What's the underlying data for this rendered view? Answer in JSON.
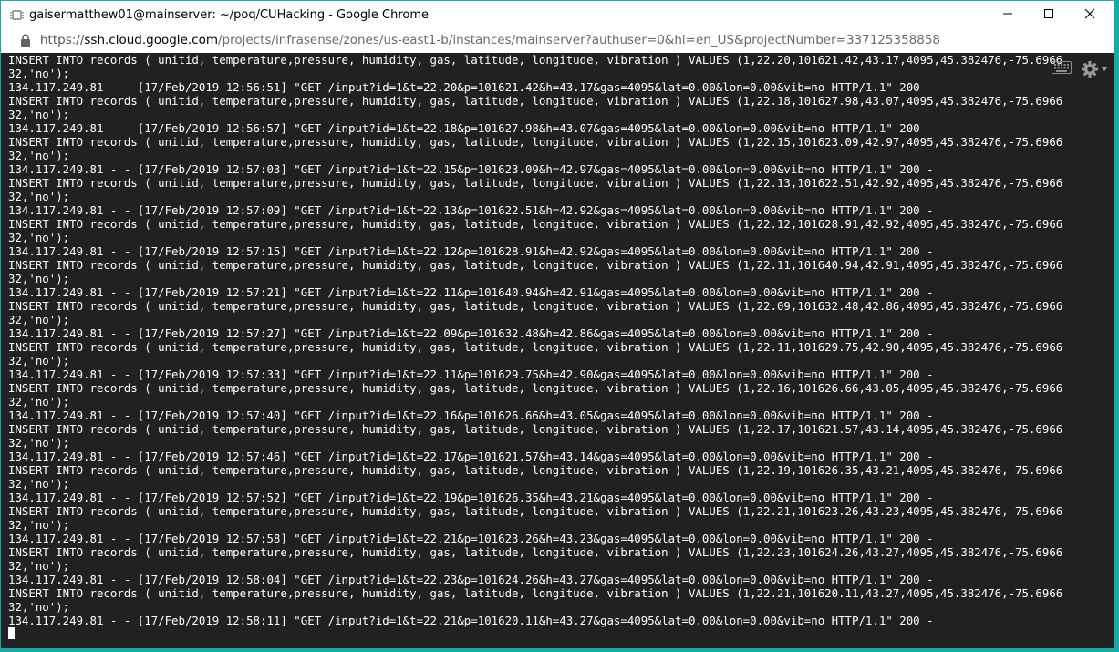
{
  "window": {
    "title": "gaisermatthew01@mainserver: ~/poq/CUHacking - Google Chrome"
  },
  "address": {
    "scheme": "https://",
    "host": "ssh.cloud.google.com",
    "path": "/projects/infrasense/zones/us-east1-b/instances/mainserver?authuser=0&hl=en_US&projectNumber=337125358858"
  },
  "icons": {
    "app": "terminal-app-icon",
    "lock": "lock-icon",
    "minimize": "minimize-icon",
    "maximize": "maximize-icon",
    "close": "close-icon",
    "keyboard": "keyboard-icon",
    "settings": "gear-icon"
  },
  "terminal": {
    "lines": [
      "INSERT INTO records ( unitid, temperature,pressure, humidity, gas, latitude, longitude, vibration ) VALUES (1,22.20,101621.42,43.17,4095,45.382476,-75.6966",
      "32,'no');",
      "134.117.249.81 - - [17/Feb/2019 12:56:51] \"GET /input?id=1&t=22.20&p=101621.42&h=43.17&gas=4095&lat=0.00&lon=0.00&vib=no HTTP/1.1\" 200 -",
      "INSERT INTO records ( unitid, temperature,pressure, humidity, gas, latitude, longitude, vibration ) VALUES (1,22.18,101627.98,43.07,4095,45.382476,-75.6966",
      "32,'no');",
      "134.117.249.81 - - [17/Feb/2019 12:56:57] \"GET /input?id=1&t=22.18&p=101627.98&h=43.07&gas=4095&lat=0.00&lon=0.00&vib=no HTTP/1.1\" 200 -",
      "INSERT INTO records ( unitid, temperature,pressure, humidity, gas, latitude, longitude, vibration ) VALUES (1,22.15,101623.09,42.97,4095,45.382476,-75.6966",
      "32,'no');",
      "134.117.249.81 - - [17/Feb/2019 12:57:03] \"GET /input?id=1&t=22.15&p=101623.09&h=42.97&gas=4095&lat=0.00&lon=0.00&vib=no HTTP/1.1\" 200 -",
      "INSERT INTO records ( unitid, temperature,pressure, humidity, gas, latitude, longitude, vibration ) VALUES (1,22.13,101622.51,42.92,4095,45.382476,-75.6966",
      "32,'no');",
      "134.117.249.81 - - [17/Feb/2019 12:57:09] \"GET /input?id=1&t=22.13&p=101622.51&h=42.92&gas=4095&lat=0.00&lon=0.00&vib=no HTTP/1.1\" 200 -",
      "INSERT INTO records ( unitid, temperature,pressure, humidity, gas, latitude, longitude, vibration ) VALUES (1,22.12,101628.91,42.92,4095,45.382476,-75.6966",
      "32,'no');",
      "134.117.249.81 - - [17/Feb/2019 12:57:15] \"GET /input?id=1&t=22.12&p=101628.91&h=42.92&gas=4095&lat=0.00&lon=0.00&vib=no HTTP/1.1\" 200 -",
      "INSERT INTO records ( unitid, temperature,pressure, humidity, gas, latitude, longitude, vibration ) VALUES (1,22.11,101640.94,42.91,4095,45.382476,-75.6966",
      "32,'no');",
      "134.117.249.81 - - [17/Feb/2019 12:57:21] \"GET /input?id=1&t=22.11&p=101640.94&h=42.91&gas=4095&lat=0.00&lon=0.00&vib=no HTTP/1.1\" 200 -",
      "INSERT INTO records ( unitid, temperature,pressure, humidity, gas, latitude, longitude, vibration ) VALUES (1,22.09,101632.48,42.86,4095,45.382476,-75.6966",
      "32,'no');",
      "134.117.249.81 - - [17/Feb/2019 12:57:27] \"GET /input?id=1&t=22.09&p=101632.48&h=42.86&gas=4095&lat=0.00&lon=0.00&vib=no HTTP/1.1\" 200 -",
      "INSERT INTO records ( unitid, temperature,pressure, humidity, gas, latitude, longitude, vibration ) VALUES (1,22.11,101629.75,42.90,4095,45.382476,-75.6966",
      "32,'no');",
      "134.117.249.81 - - [17/Feb/2019 12:57:33] \"GET /input?id=1&t=22.11&p=101629.75&h=42.90&gas=4095&lat=0.00&lon=0.00&vib=no HTTP/1.1\" 200 -",
      "INSERT INTO records ( unitid, temperature,pressure, humidity, gas, latitude, longitude, vibration ) VALUES (1,22.16,101626.66,43.05,4095,45.382476,-75.6966",
      "32,'no');",
      "134.117.249.81 - - [17/Feb/2019 12:57:40] \"GET /input?id=1&t=22.16&p=101626.66&h=43.05&gas=4095&lat=0.00&lon=0.00&vib=no HTTP/1.1\" 200 -",
      "INSERT INTO records ( unitid, temperature,pressure, humidity, gas, latitude, longitude, vibration ) VALUES (1,22.17,101621.57,43.14,4095,45.382476,-75.6966",
      "32,'no');",
      "134.117.249.81 - - [17/Feb/2019 12:57:46] \"GET /input?id=1&t=22.17&p=101621.57&h=43.14&gas=4095&lat=0.00&lon=0.00&vib=no HTTP/1.1\" 200 -",
      "INSERT INTO records ( unitid, temperature,pressure, humidity, gas, latitude, longitude, vibration ) VALUES (1,22.19,101626.35,43.21,4095,45.382476,-75.6966",
      "32,'no');",
      "134.117.249.81 - - [17/Feb/2019 12:57:52] \"GET /input?id=1&t=22.19&p=101626.35&h=43.21&gas=4095&lat=0.00&lon=0.00&vib=no HTTP/1.1\" 200 -",
      "INSERT INTO records ( unitid, temperature,pressure, humidity, gas, latitude, longitude, vibration ) VALUES (1,22.21,101623.26,43.23,4095,45.382476,-75.6966",
      "32,'no');",
      "134.117.249.81 - - [17/Feb/2019 12:57:58] \"GET /input?id=1&t=22.21&p=101623.26&h=43.23&gas=4095&lat=0.00&lon=0.00&vib=no HTTP/1.1\" 200 -",
      "INSERT INTO records ( unitid, temperature,pressure, humidity, gas, latitude, longitude, vibration ) VALUES (1,22.23,101624.26,43.27,4095,45.382476,-75.6966",
      "32,'no');",
      "134.117.249.81 - - [17/Feb/2019 12:58:04] \"GET /input?id=1&t=22.23&p=101624.26&h=43.27&gas=4095&lat=0.00&lon=0.00&vib=no HTTP/1.1\" 200 -",
      "INSERT INTO records ( unitid, temperature,pressure, humidity, gas, latitude, longitude, vibration ) VALUES (1,22.21,101620.11,43.27,4095,45.382476,-75.6966",
      "32,'no');",
      "134.117.249.81 - - [17/Feb/2019 12:58:11] \"GET /input?id=1&t=22.21&p=101620.11&h=43.27&gas=4095&lat=0.00&lon=0.00&vib=no HTTP/1.1\" 200 -"
    ]
  },
  "colors": {
    "terminal_bg": "#212121",
    "terminal_fg": "#ffffff",
    "window_border": "#1aa9a7"
  }
}
